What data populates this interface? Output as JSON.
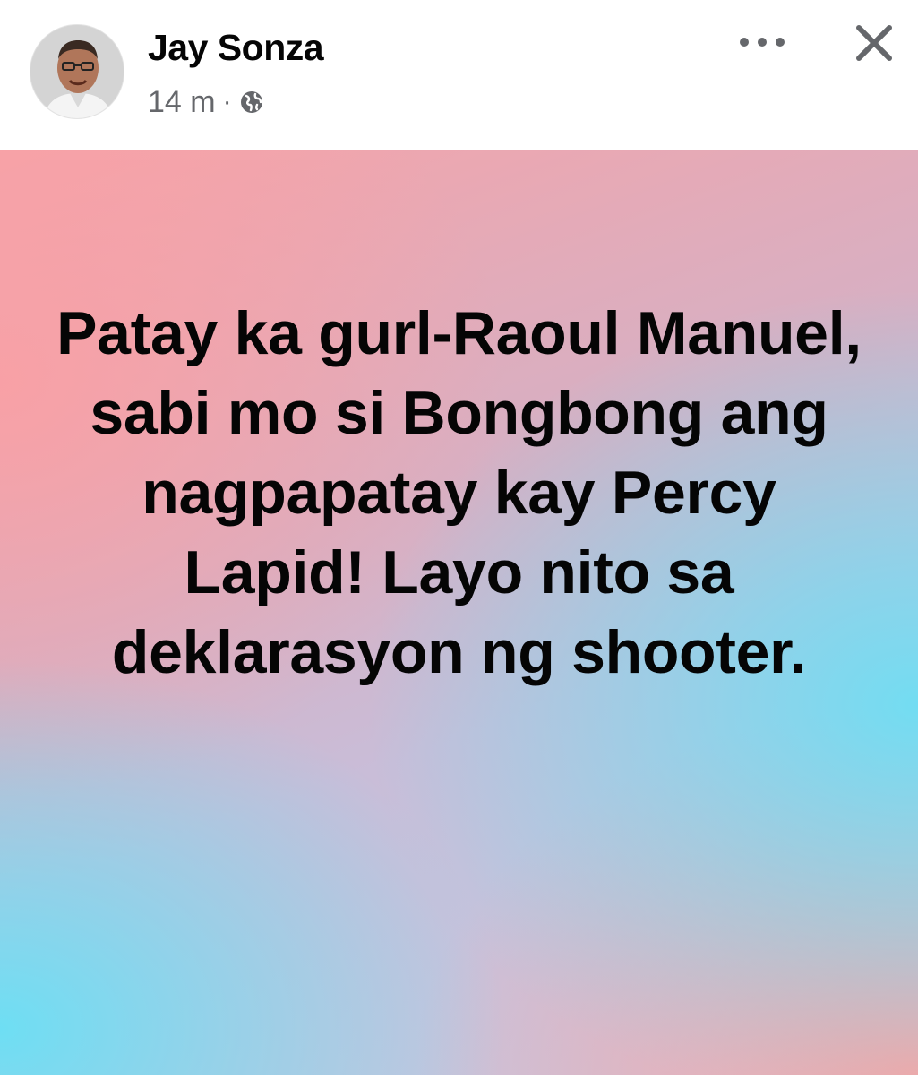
{
  "post": {
    "author": "Jay Sonza",
    "time": "14 m",
    "separator": "·",
    "privacy_icon": "globe-icon",
    "more_icon": "more-options-icon",
    "close_icon": "close-icon",
    "text": "Patay ka gurl-Raoul Manuel, sabi mo si Bongbong ang nagpapatay kay Percy Lapid! Layo nito sa deklarasyon ng shooter.",
    "background_colors": {
      "pink": "#f6a3a8",
      "cyan": "#6edef3",
      "lavender": "#c9bdd8"
    }
  },
  "colors": {
    "name_text": "#050505",
    "meta_text": "#65676b",
    "header_bg": "#ffffff"
  }
}
